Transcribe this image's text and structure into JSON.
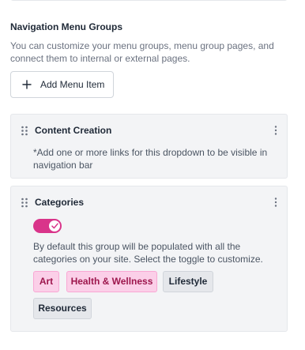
{
  "section": {
    "title": "Navigation Menu Groups",
    "description": "You can customize your menu groups, menu group pages, and connect them to internal or external pages."
  },
  "add_button": {
    "label": "Add Menu Item",
    "icon": "plus-icon"
  },
  "groups": [
    {
      "title": "Content Creation",
      "note": "*Add one or more links for this dropdown to be visible in navigation bar"
    },
    {
      "title": "Categories",
      "toggle_on": true,
      "description": "By default this group will be populated with all the categories on your site. Select the toggle to customize.",
      "tags": [
        {
          "label": "Art",
          "selected": true
        },
        {
          "label": "Health & Wellness",
          "selected": true
        },
        {
          "label": "Lifestyle",
          "selected": false
        },
        {
          "label": "Resources",
          "selected": false
        }
      ]
    }
  ],
  "colors": {
    "accent": "#d9348a",
    "tag_selected_bg": "#fbcfe8",
    "tag_unselected_bg": "#e5e7eb",
    "card_bg": "#f3f4f6"
  }
}
